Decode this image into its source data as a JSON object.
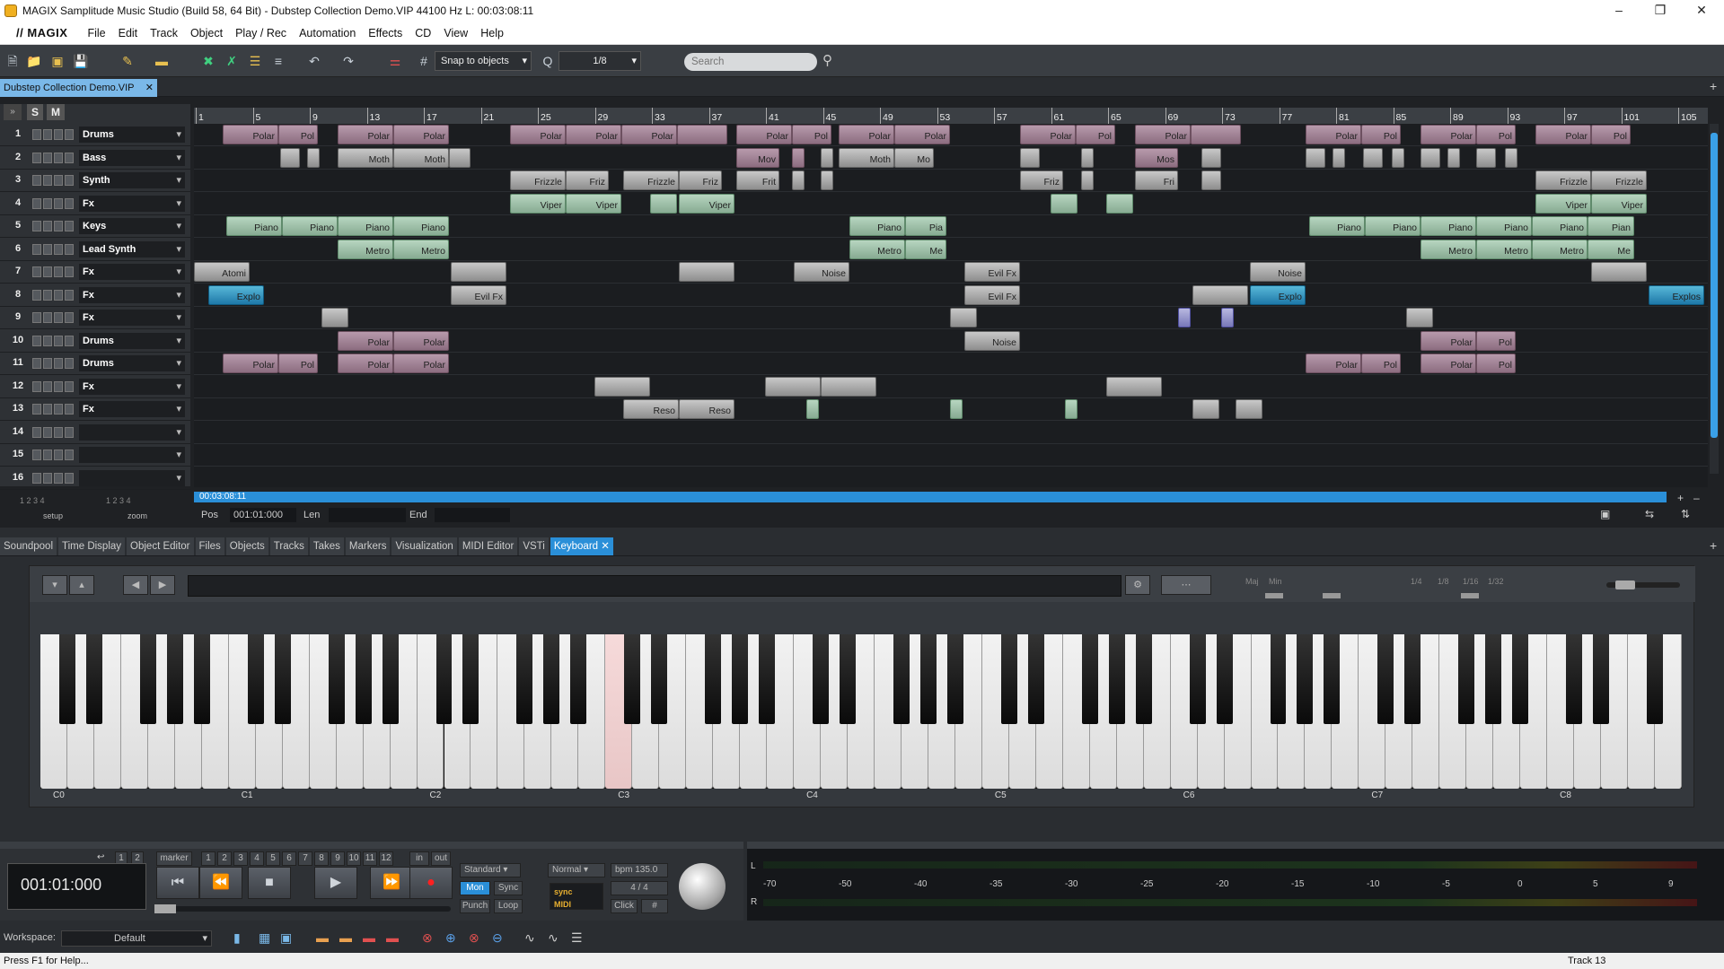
{
  "window": {
    "title": "MAGIX Samplitude Music Studio (Build 58, 64 Bit)  -  Dubstep Collection Demo.VIP   44100 Hz L: 00:03:08:11"
  },
  "menu": {
    "logo": "// MAGIX",
    "items": [
      "File",
      "Edit",
      "Track",
      "Object",
      "Play / Rec",
      "Automation",
      "Effects",
      "CD",
      "View",
      "Help"
    ]
  },
  "toolbar": {
    "snap": "Snap to objects",
    "grid": "1/8",
    "search_placeholder": "Search"
  },
  "project_tab": "Dubstep Collection Demo.VIP",
  "ruler": [
    "1",
    "5",
    "9",
    "13",
    "17",
    "21",
    "25",
    "29",
    "33",
    "37",
    "41",
    "45",
    "49",
    "53",
    "57",
    "61",
    "65",
    "69",
    "73",
    "77",
    "81",
    "85",
    "89",
    "93",
    "97",
    "101",
    "105"
  ],
  "tracks": [
    {
      "num": "1",
      "name": "Drums"
    },
    {
      "num": "2",
      "name": "Bass"
    },
    {
      "num": "3",
      "name": "Synth"
    },
    {
      "num": "4",
      "name": "Fx"
    },
    {
      "num": "5",
      "name": "Keys"
    },
    {
      "num": "6",
      "name": "Lead Synth"
    },
    {
      "num": "7",
      "name": "Fx"
    },
    {
      "num": "8",
      "name": "Fx"
    },
    {
      "num": "9",
      "name": "Fx"
    },
    {
      "num": "10",
      "name": "Drums"
    },
    {
      "num": "11",
      "name": "Drums"
    },
    {
      "num": "12",
      "name": "Fx"
    },
    {
      "num": "13",
      "name": "Fx"
    },
    {
      "num": "14",
      "name": ""
    },
    {
      "num": "15",
      "name": ""
    },
    {
      "num": "16",
      "name": ""
    }
  ],
  "clips": [
    {
      "t": 0,
      "l": 32,
      "w": 62,
      "c": "cp",
      "n": "Polar"
    },
    {
      "t": 0,
      "l": 94,
      "w": 44,
      "c": "cp",
      "n": "Pol"
    },
    {
      "t": 0,
      "l": 160,
      "w": 62,
      "c": "cp",
      "n": "Polar"
    },
    {
      "t": 0,
      "l": 222,
      "w": 62,
      "c": "cp",
      "n": "Polar"
    },
    {
      "t": 0,
      "l": 352,
      "w": 62,
      "c": "cp",
      "n": "Polar"
    },
    {
      "t": 0,
      "l": 414,
      "w": 62,
      "c": "cp",
      "n": "Polar"
    },
    {
      "t": 0,
      "l": 476,
      "w": 62,
      "c": "cp",
      "n": "Polar"
    },
    {
      "t": 0,
      "l": 538,
      "w": 56,
      "c": "cp",
      "n": ""
    },
    {
      "t": 0,
      "l": 604,
      "w": 62,
      "c": "cp",
      "n": "Polar"
    },
    {
      "t": 0,
      "l": 666,
      "w": 44,
      "c": "cp",
      "n": "Pol"
    },
    {
      "t": 0,
      "l": 718,
      "w": 62,
      "c": "cp",
      "n": "Polar"
    },
    {
      "t": 0,
      "l": 780,
      "w": 62,
      "c": "cp",
      "n": "Polar"
    },
    {
      "t": 0,
      "l": 920,
      "w": 62,
      "c": "cp",
      "n": "Polar"
    },
    {
      "t": 0,
      "l": 982,
      "w": 44,
      "c": "cp",
      "n": "Pol"
    },
    {
      "t": 0,
      "l": 1048,
      "w": 62,
      "c": "cp",
      "n": "Polar"
    },
    {
      "t": 0,
      "l": 1110,
      "w": 56,
      "c": "cp",
      "n": ""
    },
    {
      "t": 0,
      "l": 1238,
      "w": 62,
      "c": "cp",
      "n": "Polar"
    },
    {
      "t": 0,
      "l": 1300,
      "w": 44,
      "c": "cp",
      "n": "Pol"
    },
    {
      "t": 0,
      "l": 1366,
      "w": 62,
      "c": "cp",
      "n": "Polar"
    },
    {
      "t": 0,
      "l": 1428,
      "w": 44,
      "c": "cp",
      "n": "Pol"
    },
    {
      "t": 0,
      "l": 1494,
      "w": 62,
      "c": "cp",
      "n": "Polar"
    },
    {
      "t": 0,
      "l": 1556,
      "w": 44,
      "c": "cp",
      "n": "Pol"
    },
    {
      "t": 1,
      "l": 96,
      "w": 22,
      "c": "cgr",
      "n": ""
    },
    {
      "t": 1,
      "l": 126,
      "w": 14,
      "c": "cgr",
      "n": ""
    },
    {
      "t": 1,
      "l": 160,
      "w": 62,
      "c": "cgr",
      "n": "Moth"
    },
    {
      "t": 1,
      "l": 222,
      "w": 62,
      "c": "cgr",
      "n": "Moth"
    },
    {
      "t": 1,
      "l": 284,
      "w": 24,
      "c": "cgr",
      "n": ""
    },
    {
      "t": 1,
      "l": 604,
      "w": 48,
      "c": "cp",
      "n": "Mov"
    },
    {
      "t": 1,
      "l": 666,
      "w": 14,
      "c": "cp",
      "n": ""
    },
    {
      "t": 1,
      "l": 698,
      "w": 14,
      "c": "cgr",
      "n": ""
    },
    {
      "t": 1,
      "l": 718,
      "w": 62,
      "c": "cgr",
      "n": "Moth"
    },
    {
      "t": 1,
      "l": 780,
      "w": 44,
      "c": "cgr",
      "n": "Mo"
    },
    {
      "t": 1,
      "l": 920,
      "w": 22,
      "c": "cgr",
      "n": ""
    },
    {
      "t": 1,
      "l": 988,
      "w": 14,
      "c": "cgr",
      "n": ""
    },
    {
      "t": 1,
      "l": 1048,
      "w": 48,
      "c": "cp",
      "n": "Mos"
    },
    {
      "t": 1,
      "l": 1122,
      "w": 22,
      "c": "cgr",
      "n": ""
    },
    {
      "t": 1,
      "l": 1238,
      "w": 22,
      "c": "cgr",
      "n": ""
    },
    {
      "t": 1,
      "l": 1268,
      "w": 14,
      "c": "cgr",
      "n": ""
    },
    {
      "t": 1,
      "l": 1302,
      "w": 22,
      "c": "cgr",
      "n": ""
    },
    {
      "t": 1,
      "l": 1334,
      "w": 14,
      "c": "cgr",
      "n": ""
    },
    {
      "t": 1,
      "l": 1366,
      "w": 22,
      "c": "cgr",
      "n": ""
    },
    {
      "t": 1,
      "l": 1396,
      "w": 14,
      "c": "cgr",
      "n": ""
    },
    {
      "t": 1,
      "l": 1428,
      "w": 22,
      "c": "cgr",
      "n": ""
    },
    {
      "t": 1,
      "l": 1460,
      "w": 14,
      "c": "cgr",
      "n": ""
    },
    {
      "t": 2,
      "l": 352,
      "w": 62,
      "c": "cgr",
      "n": "Frizzle"
    },
    {
      "t": 2,
      "l": 414,
      "w": 48,
      "c": "cgr",
      "n": "Friz"
    },
    {
      "t": 2,
      "l": 478,
      "w": 62,
      "c": "cgr",
      "n": "Frizzle"
    },
    {
      "t": 2,
      "l": 540,
      "w": 48,
      "c": "cgr",
      "n": "Friz"
    },
    {
      "t": 2,
      "l": 604,
      "w": 48,
      "c": "cgr",
      "n": "Frit"
    },
    {
      "t": 2,
      "l": 666,
      "w": 14,
      "c": "cgr",
      "n": ""
    },
    {
      "t": 2,
      "l": 698,
      "w": 14,
      "c": "cgr",
      "n": ""
    },
    {
      "t": 2,
      "l": 920,
      "w": 48,
      "c": "cgr",
      "n": "Friz"
    },
    {
      "t": 2,
      "l": 988,
      "w": 14,
      "c": "cgr",
      "n": ""
    },
    {
      "t": 2,
      "l": 1048,
      "w": 48,
      "c": "cgr",
      "n": "Fri"
    },
    {
      "t": 2,
      "l": 1122,
      "w": 22,
      "c": "cgr",
      "n": ""
    },
    {
      "t": 2,
      "l": 1494,
      "w": 62,
      "c": "cgr",
      "n": "Frizzle"
    },
    {
      "t": 2,
      "l": 1556,
      "w": 62,
      "c": "cgr",
      "n": "Frizzle"
    },
    {
      "t": 3,
      "l": 352,
      "w": 62,
      "c": "cg",
      "n": "Viper"
    },
    {
      "t": 3,
      "l": 414,
      "w": 62,
      "c": "cg",
      "n": "Viper"
    },
    {
      "t": 3,
      "l": 508,
      "w": 30,
      "c": "cg",
      "n": ""
    },
    {
      "t": 3,
      "l": 540,
      "w": 62,
      "c": "cg",
      "n": "Viper"
    },
    {
      "t": 3,
      "l": 954,
      "w": 30,
      "c": "cg",
      "n": ""
    },
    {
      "t": 3,
      "l": 1016,
      "w": 30,
      "c": "cg",
      "n": ""
    },
    {
      "t": 3,
      "l": 1494,
      "w": 62,
      "c": "cg",
      "n": "Viper"
    },
    {
      "t": 3,
      "l": 1556,
      "w": 62,
      "c": "cg",
      "n": "Viper"
    },
    {
      "t": 4,
      "l": 36,
      "w": 62,
      "c": "cg",
      "n": "Piano"
    },
    {
      "t": 4,
      "l": 98,
      "w": 62,
      "c": "cg",
      "n": "Piano"
    },
    {
      "t": 4,
      "l": 160,
      "w": 62,
      "c": "cg",
      "n": "Piano"
    },
    {
      "t": 4,
      "l": 222,
      "w": 62,
      "c": "cg",
      "n": "Piano"
    },
    {
      "t": 4,
      "l": 730,
      "w": 62,
      "c": "cg",
      "n": "Piano"
    },
    {
      "t": 4,
      "l": 792,
      "w": 46,
      "c": "cg",
      "n": "Pia"
    },
    {
      "t": 4,
      "l": 1242,
      "w": 62,
      "c": "cg",
      "n": "Piano"
    },
    {
      "t": 4,
      "l": 1304,
      "w": 62,
      "c": "cg",
      "n": "Piano"
    },
    {
      "t": 4,
      "l": 1366,
      "w": 62,
      "c": "cg",
      "n": "Piano"
    },
    {
      "t": 4,
      "l": 1428,
      "w": 62,
      "c": "cg",
      "n": "Piano"
    },
    {
      "t": 4,
      "l": 1490,
      "w": 62,
      "c": "cg",
      "n": "Piano"
    },
    {
      "t": 4,
      "l": 1552,
      "w": 52,
      "c": "cg",
      "n": "Pian"
    },
    {
      "t": 5,
      "l": 160,
      "w": 62,
      "c": "cg",
      "n": "Metro"
    },
    {
      "t": 5,
      "l": 222,
      "w": 62,
      "c": "cg",
      "n": "Metro"
    },
    {
      "t": 5,
      "l": 730,
      "w": 62,
      "c": "cg",
      "n": "Metro"
    },
    {
      "t": 5,
      "l": 792,
      "w": 46,
      "c": "cg",
      "n": "Me"
    },
    {
      "t": 5,
      "l": 1366,
      "w": 62,
      "c": "cg",
      "n": "Metro"
    },
    {
      "t": 5,
      "l": 1428,
      "w": 62,
      "c": "cg",
      "n": "Metro"
    },
    {
      "t": 5,
      "l": 1490,
      "w": 62,
      "c": "cg",
      "n": "Metro"
    },
    {
      "t": 5,
      "l": 1552,
      "w": 52,
      "c": "cg",
      "n": "Me"
    },
    {
      "t": 6,
      "l": 0,
      "w": 62,
      "c": "cgr",
      "n": "Atomi"
    },
    {
      "t": 6,
      "l": 286,
      "w": 62,
      "c": "cgr",
      "n": ""
    },
    {
      "t": 6,
      "l": 540,
      "w": 62,
      "c": "cgr",
      "n": ""
    },
    {
      "t": 6,
      "l": 668,
      "w": 62,
      "c": "cgr",
      "n": "Noise"
    },
    {
      "t": 6,
      "l": 858,
      "w": 62,
      "c": "cgr",
      "n": "Evil Fx"
    },
    {
      "t": 6,
      "l": 1176,
      "w": 62,
      "c": "cgr",
      "n": "Noise"
    },
    {
      "t": 6,
      "l": 1556,
      "w": 62,
      "c": "cgr",
      "n": ""
    },
    {
      "t": 7,
      "l": 16,
      "w": 62,
      "c": "cb",
      "n": "Explo"
    },
    {
      "t": 7,
      "l": 286,
      "w": 62,
      "c": "cgr",
      "n": "Evil Fx"
    },
    {
      "t": 7,
      "l": 858,
      "w": 62,
      "c": "cgr",
      "n": "Evil Fx"
    },
    {
      "t": 7,
      "l": 1112,
      "w": 62,
      "c": "cgr",
      "n": ""
    },
    {
      "t": 7,
      "l": 1176,
      "w": 62,
      "c": "cb",
      "n": "Explo"
    },
    {
      "t": 7,
      "l": 1620,
      "w": 62,
      "c": "cb",
      "n": "Explos"
    },
    {
      "t": 8,
      "l": 142,
      "w": 30,
      "c": "cgr",
      "n": ""
    },
    {
      "t": 8,
      "l": 842,
      "w": 30,
      "c": "cgr",
      "n": ""
    },
    {
      "t": 8,
      "l": 1096,
      "w": 14,
      "c": "cl",
      "n": ""
    },
    {
      "t": 8,
      "l": 1144,
      "w": 14,
      "c": "cl",
      "n": ""
    },
    {
      "t": 8,
      "l": 1350,
      "w": 30,
      "c": "cgr",
      "n": ""
    },
    {
      "t": 9,
      "l": 160,
      "w": 62,
      "c": "cp",
      "n": "Polar"
    },
    {
      "t": 9,
      "l": 222,
      "w": 62,
      "c": "cp",
      "n": "Polar"
    },
    {
      "t": 9,
      "l": 858,
      "w": 62,
      "c": "cgr",
      "n": "Noise"
    },
    {
      "t": 9,
      "l": 1366,
      "w": 62,
      "c": "cp",
      "n": "Polar"
    },
    {
      "t": 9,
      "l": 1428,
      "w": 44,
      "c": "cp",
      "n": "Pol"
    },
    {
      "t": 10,
      "l": 32,
      "w": 62,
      "c": "cp",
      "n": "Polar"
    },
    {
      "t": 10,
      "l": 94,
      "w": 44,
      "c": "cp",
      "n": "Pol"
    },
    {
      "t": 10,
      "l": 160,
      "w": 62,
      "c": "cp",
      "n": "Polar"
    },
    {
      "t": 10,
      "l": 222,
      "w": 62,
      "c": "cp",
      "n": "Polar"
    },
    {
      "t": 10,
      "l": 1238,
      "w": 62,
      "c": "cp",
      "n": "Polar"
    },
    {
      "t": 10,
      "l": 1300,
      "w": 44,
      "c": "cp",
      "n": "Pol"
    },
    {
      "t": 10,
      "l": 1366,
      "w": 62,
      "c": "cp",
      "n": "Polar"
    },
    {
      "t": 10,
      "l": 1428,
      "w": 44,
      "c": "cp",
      "n": "Pol"
    },
    {
      "t": 11,
      "l": 446,
      "w": 62,
      "c": "cgr",
      "n": ""
    },
    {
      "t": 11,
      "l": 636,
      "w": 62,
      "c": "cgr",
      "n": ""
    },
    {
      "t": 11,
      "l": 698,
      "w": 62,
      "c": "cgr",
      "n": ""
    },
    {
      "t": 11,
      "l": 1016,
      "w": 62,
      "c": "cgr",
      "n": ""
    },
    {
      "t": 12,
      "l": 478,
      "w": 62,
      "c": "cgr",
      "n": "Reso"
    },
    {
      "t": 12,
      "l": 540,
      "w": 62,
      "c": "cgr",
      "n": "Reso"
    },
    {
      "t": 12,
      "l": 682,
      "w": 14,
      "c": "cg",
      "n": ""
    },
    {
      "t": 12,
      "l": 842,
      "w": 14,
      "c": "cg",
      "n": ""
    },
    {
      "t": 12,
      "l": 970,
      "w": 14,
      "c": "cg",
      "n": ""
    },
    {
      "t": 12,
      "l": 1112,
      "w": 30,
      "c": "cgr",
      "n": ""
    },
    {
      "t": 12,
      "l": 1160,
      "w": 30,
      "c": "cgr",
      "n": ""
    }
  ],
  "timeline": {
    "scroll_time": "00:03:08:11",
    "pos_label": "Pos",
    "pos_value": "001:01:000",
    "len_label": "Len",
    "end_label": "End",
    "setup": "setup",
    "zoom": "zoom"
  },
  "dock_tabs": [
    "Soundpool",
    "Time Display",
    "Object Editor",
    "Files",
    "Objects",
    "Tracks",
    "Takes",
    "Markers",
    "Visualization",
    "MIDI Editor",
    "VSTi",
    "Keyboard"
  ],
  "keyboard": {
    "octaves": [
      "C0",
      "C1",
      "C2",
      "C3",
      "C4",
      "C5",
      "C6",
      "C7",
      "C8"
    ],
    "highlight_white_key_index": 21,
    "scale_labels": [
      "Maj",
      "Min",
      "1/4",
      "1/8",
      "1/16",
      "1/32"
    ]
  },
  "transport": {
    "time": "001:01:000",
    "marker_label": "marker",
    "marker_nums": [
      "1",
      "2",
      "3",
      "4",
      "5",
      "6",
      "7",
      "8",
      "9",
      "10",
      "11",
      "12"
    ],
    "in": "in",
    "out": "out",
    "mode": "Standard",
    "mon": "Mon",
    "sync": "Sync",
    "punch": "Punch",
    "loop": "Loop",
    "normal": "Normal",
    "bpm": "bpm 135.0",
    "sig": "4 / 4",
    "click": "Click",
    "sync_small": "sync",
    "midi": "MIDI"
  },
  "meter": {
    "scale": [
      "-70",
      "-50",
      "-40",
      "-35",
      "-30",
      "-25",
      "-20",
      "-15",
      "-10",
      "-5",
      "0",
      "5",
      "9"
    ],
    "l": "L",
    "r": "R"
  },
  "workspace": {
    "label": "Workspace:",
    "value": "Default"
  },
  "status": {
    "help": "Press F1 for Help...",
    "track": "Track 13"
  }
}
